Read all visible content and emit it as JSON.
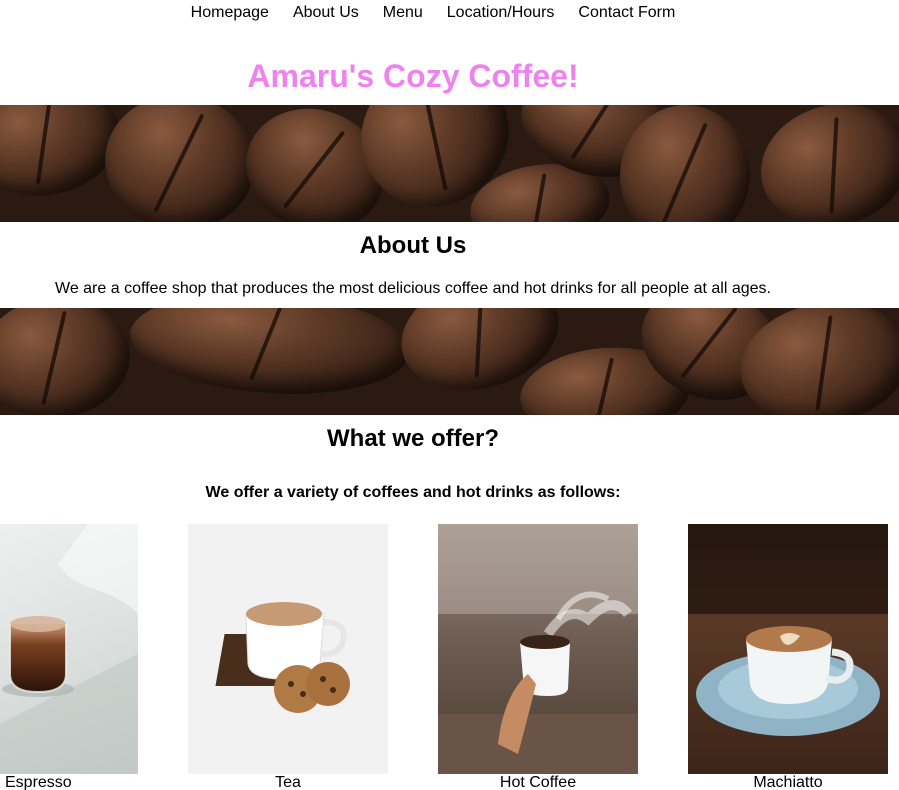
{
  "nav": {
    "items": [
      "Homepage",
      "About Us",
      "Menu",
      "Location/Hours",
      "Contact Form"
    ]
  },
  "site": {
    "title": "Amaru's Cozy Coffee!",
    "title_color": "#ee82ee"
  },
  "about": {
    "heading": "About Us",
    "text": "We are a coffee shop that produces the most delicious coffee and hot drinks for all people at all ages."
  },
  "offer": {
    "heading": "What we offer?",
    "text": "We offer a variety of coffees and hot drinks as follows:"
  },
  "products": [
    {
      "name": "Espresso",
      "icon": "espresso-glass-photo"
    },
    {
      "name": "Tea",
      "icon": "tea-cup-cookies-photo"
    },
    {
      "name": "Hot Coffee",
      "icon": "hand-holding-steaming-cup-photo"
    },
    {
      "name": "Machiatto",
      "icon": "macchiato-cup-saucer-photo"
    }
  ],
  "banners": [
    "coffee-beans-banner",
    "coffee-beans-banner"
  ]
}
